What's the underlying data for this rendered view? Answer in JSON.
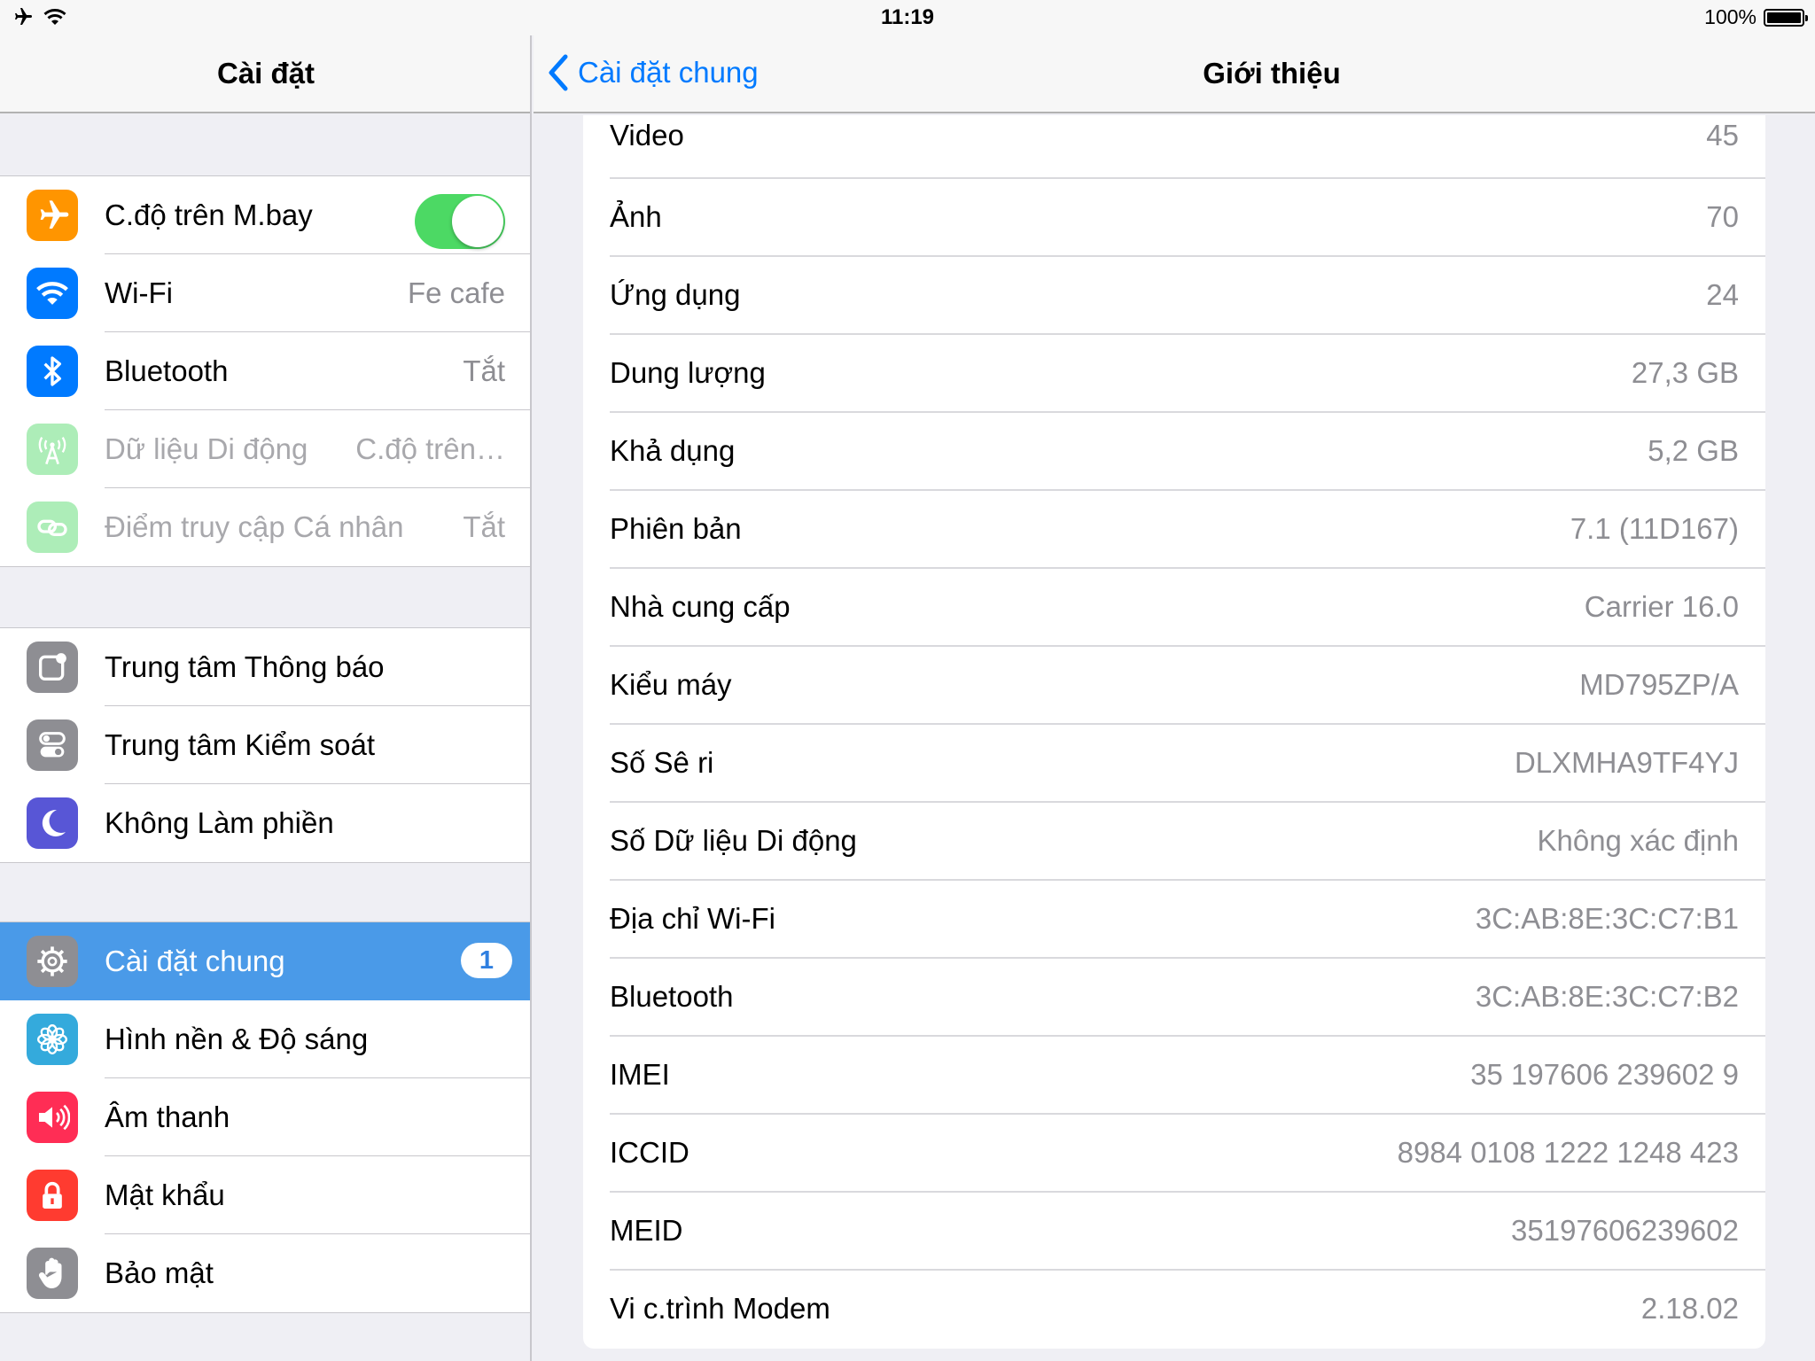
{
  "status_bar": {
    "time": "11:19",
    "battery_text": "100%",
    "battery_level": 1.0
  },
  "left": {
    "title": "Cài đặt",
    "groups": [
      {
        "items": [
          {
            "label": "C.độ trên M.bay",
            "icon": "airplane-icon",
            "toggle_on": true
          },
          {
            "label": "Wi-Fi",
            "detail": "Fe cafe",
            "icon": "wifi-icon"
          },
          {
            "label": "Bluetooth",
            "detail": "Tắt",
            "icon": "bluetooth-icon"
          },
          {
            "label": "Dữ liệu Di động",
            "detail": "C.độ trên…",
            "icon": "cellular-icon",
            "disabled": true
          },
          {
            "label": "Điểm truy cập Cá nhân",
            "detail": "Tắt",
            "icon": "hotspot-icon",
            "disabled": true
          }
        ]
      },
      {
        "items": [
          {
            "label": "Trung tâm Thông báo",
            "icon": "notification-center-icon"
          },
          {
            "label": "Trung tâm Kiểm soát",
            "icon": "control-center-icon"
          },
          {
            "label": "Không Làm phiền",
            "icon": "moon-icon"
          }
        ]
      },
      {
        "items": [
          {
            "label": "Cài đặt chung",
            "badge": "1",
            "icon": "gear-icon",
            "selected": true
          },
          {
            "label": "Hình nền & Độ sáng",
            "icon": "flower-icon"
          },
          {
            "label": "Âm thanh",
            "icon": "speaker-icon"
          },
          {
            "label": "Mật khẩu",
            "icon": "lock-icon"
          },
          {
            "label": "Bảo mật",
            "icon": "hand-icon"
          }
        ]
      }
    ]
  },
  "right": {
    "back_label": "Cài đặt chung",
    "title": "Giới thiệu",
    "rows": [
      {
        "label": "Video",
        "value": "45"
      },
      {
        "label": "Ảnh",
        "value": "70"
      },
      {
        "label": "Ứng dụng",
        "value": "24"
      },
      {
        "label": "Dung lượng",
        "value": "27,3 GB"
      },
      {
        "label": "Khả dụng",
        "value": "5,2 GB"
      },
      {
        "label": "Phiên bản",
        "value": "7.1 (11D167)"
      },
      {
        "label": "Nhà cung cấp",
        "value": "Carrier 16.0"
      },
      {
        "label": "Kiểu máy",
        "value": "MD795ZP/A"
      },
      {
        "label": "Số Sê ri",
        "value": "DLXMHA9TF4YJ"
      },
      {
        "label": "Số Dữ liệu Di động",
        "value": "Không xác định"
      },
      {
        "label": "Địa chỉ Wi-Fi",
        "value": "3C:AB:8E:3C:C7:B1"
      },
      {
        "label": "Bluetooth",
        "value": "3C:AB:8E:3C:C7:B2"
      },
      {
        "label": "IMEI",
        "value": "35 197606 239602 9"
      },
      {
        "label": "ICCID",
        "value": "8984 0108 1222 1248 423"
      },
      {
        "label": "MEID",
        "value": "35197606239602"
      },
      {
        "label": "Vi c.trình Modem",
        "value": "2.18.02"
      }
    ]
  },
  "colors": {
    "accent": "#007aff",
    "toggle_on": "#4cd964",
    "selected_row": "#4a9ae8",
    "detail_text": "#8e8e93"
  }
}
